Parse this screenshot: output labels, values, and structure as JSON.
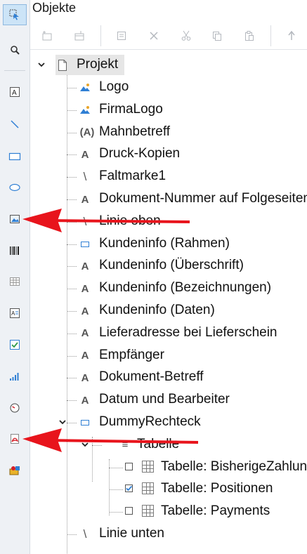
{
  "panel": {
    "title": "Objekte"
  },
  "left_toolbar": [
    {
      "name": "select-tool",
      "active": true
    },
    {
      "name": "zoom-tool"
    },
    {
      "name": "text-tool"
    },
    {
      "name": "line-tool"
    },
    {
      "name": "rectangle-tool"
    },
    {
      "name": "ellipse-tool"
    },
    {
      "name": "picture-tool"
    },
    {
      "name": "barcode-tool"
    },
    {
      "name": "table-tool"
    },
    {
      "name": "formatted-text-tool"
    },
    {
      "name": "checkbox-tool"
    },
    {
      "name": "chart-tool"
    },
    {
      "name": "gauge-tool"
    },
    {
      "name": "pdf-object-tool"
    },
    {
      "name": "ole-object-tool"
    }
  ],
  "top_toolbar": [
    "insert-object",
    "append-object",
    "properties",
    "delete",
    "cut",
    "copy",
    "paste",
    "move-up"
  ],
  "tree": {
    "root": "Projekt",
    "items": [
      {
        "label": "Logo",
        "icon": "picture"
      },
      {
        "label": "FirmaLogo",
        "icon": "picture"
      },
      {
        "label": "Mahnbetreff",
        "icon": "formatted-text",
        "glyph": "(A)"
      },
      {
        "label": "Druck-Kopien",
        "icon": "text",
        "glyph": "A"
      },
      {
        "label": "Faltmarke1",
        "icon": "line",
        "glyph": "\\"
      },
      {
        "label": "Dokument-Nummer auf Folgeseiten",
        "icon": "text",
        "glyph": "A"
      },
      {
        "label": "Linie oben",
        "icon": "line",
        "glyph": "\\"
      },
      {
        "label": "Kundeninfo (Rahmen)",
        "icon": "rectangle"
      },
      {
        "label": "Kundeninfo (Überschrift)",
        "icon": "text",
        "glyph": "A"
      },
      {
        "label": "Kundeninfo (Bezeichnungen)",
        "icon": "text",
        "glyph": "A"
      },
      {
        "label": "Kundeninfo (Daten)",
        "icon": "text",
        "glyph": "A"
      },
      {
        "label": "Lieferadresse bei Lieferschein",
        "icon": "text",
        "glyph": "A"
      },
      {
        "label": "Empfänger",
        "icon": "text",
        "glyph": "A"
      },
      {
        "label": "Dokument-Betreff",
        "icon": "text",
        "glyph": "A"
      },
      {
        "label": "Datum und Bearbeiter",
        "icon": "text",
        "glyph": "A"
      },
      {
        "label": "DummyRechteck",
        "icon": "rectangle"
      },
      {
        "label": "Tabelle",
        "icon": "table-list",
        "glyph": "≡"
      },
      {
        "label": "Tabelle: BisherigeZahlungen",
        "icon": "table",
        "checked": false
      },
      {
        "label": "Tabelle: Positionen",
        "icon": "table",
        "checked": true
      },
      {
        "label": "Tabelle: Payments",
        "icon": "table",
        "checked": false
      },
      {
        "label": "Linie unten",
        "icon": "line",
        "glyph": "\\"
      }
    ]
  },
  "colors": {
    "arrow": "#e8141c",
    "selected_bg": "#e6e6e6",
    "accent": "#2f7fd4"
  }
}
